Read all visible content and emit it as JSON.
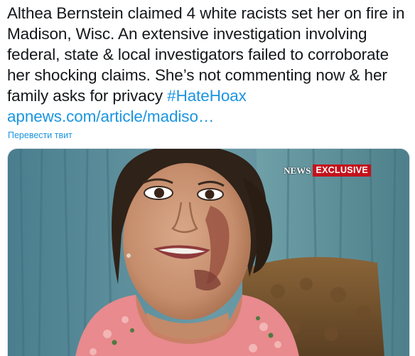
{
  "tweet": {
    "text_main": "Althea Bernstein claimed 4 white racists set her on fire in Madison, Wisc. An extensive investigation involving federal, state & local investigators failed to corroborate her shocking claims. She’s not commenting now & her family asks for privacy ",
    "hashtag": "#HateHoax",
    "link": "apnews.com/article/madiso…",
    "translate_label": "Перевести твит",
    "link_color": "#1b95e0"
  },
  "media": {
    "broadcaster_label": "NEWS",
    "exclusive_label": "EXCLUSIVE",
    "exclusive_color": "#c4121c"
  }
}
